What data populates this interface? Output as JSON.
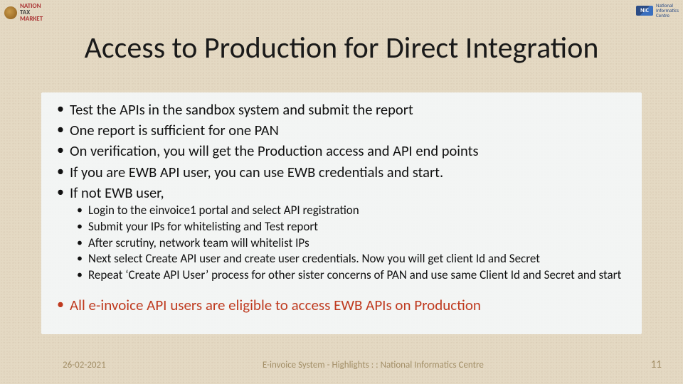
{
  "header": {
    "left_logo": {
      "line1": "NATION",
      "line2": "TAX",
      "line3": "MARKET"
    },
    "right_logo": {
      "mark": "NIC",
      "line1": "National",
      "line2": "Informatics",
      "line3": "Centre"
    }
  },
  "title": "Access to Production for Direct Integration",
  "bullets": [
    "Test the APIs in the sandbox system and submit the report",
    "One report is sufficient for one PAN",
    "On verification, you will get the Production access and API end points",
    "If you are EWB API user, you can use EWB credentials and start.",
    "If not EWB user,"
  ],
  "nested_bullets": [
    "Login to the einvoice1 portal and select API registration",
    "Submit your IPs for whitelisting and Test report",
    "After scrutiny, network team will whitelist IPs",
    "Next select Create API user and create user credentials. Now you will get client Id and Secret",
    "Repeat ‘Create API User’ process for other sister concerns of PAN and use same Client Id and Secret and start"
  ],
  "highlight": "All e-invoice API users are eligible to access EWB APIs on Production",
  "footer": {
    "date": "26-02-2021",
    "center": "E-invoice System - Highlights : : National Informatics Centre",
    "page": "11"
  }
}
